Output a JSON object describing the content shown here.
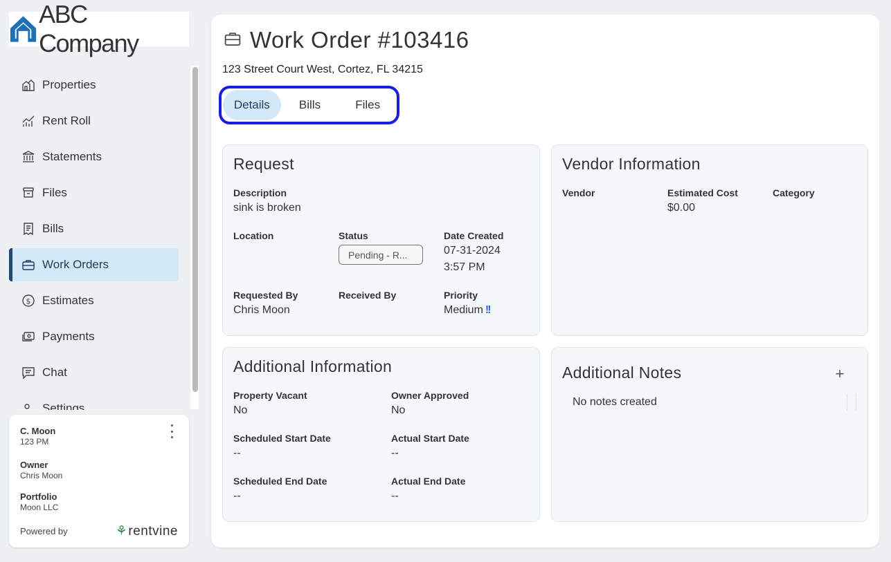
{
  "brand": {
    "logo_text": "ABC Company"
  },
  "sidebar": {
    "items": [
      {
        "label": "Properties",
        "icon": "building-icon",
        "active": false
      },
      {
        "label": "Rent Roll",
        "icon": "chart-icon",
        "active": false
      },
      {
        "label": "Statements",
        "icon": "bank-icon",
        "active": false
      },
      {
        "label": "Files",
        "icon": "archive-icon",
        "active": false
      },
      {
        "label": "Bills",
        "icon": "receipt-icon",
        "active": false
      },
      {
        "label": "Work Orders",
        "icon": "toolbox-icon",
        "active": true
      },
      {
        "label": "Estimates",
        "icon": "dollar-circle-icon",
        "active": false
      },
      {
        "label": "Payments",
        "icon": "cash-icon",
        "active": false
      },
      {
        "label": "Chat",
        "icon": "chat-icon",
        "active": false
      },
      {
        "label": "Settings",
        "icon": "settings-icon",
        "active": false
      }
    ]
  },
  "user_card": {
    "name": "C. Moon",
    "unit": "123 PM",
    "owner_label": "Owner",
    "owner_value": "Chris Moon",
    "portfolio_label": "Portfolio",
    "portfolio_value": "Moon LLC",
    "powered_by": "Powered by",
    "powered_brand": "rentvine"
  },
  "header": {
    "title": "Work Order #103416",
    "address": "123 Street Court West, Cortez, FL 34215"
  },
  "tabs": [
    {
      "label": "Details",
      "active": true
    },
    {
      "label": "Bills",
      "active": false
    },
    {
      "label": "Files",
      "active": false
    }
  ],
  "request": {
    "title": "Request",
    "description_label": "Description",
    "description_value": "sink is broken",
    "location_label": "Location",
    "status_label": "Status",
    "status_value": "Pending - R...",
    "date_created_label": "Date Created",
    "date_created_date": "07-31-2024",
    "date_created_time": "3:57 PM",
    "requested_by_label": "Requested By",
    "requested_by_value": "Chris Moon",
    "received_by_label": "Received By",
    "priority_label": "Priority",
    "priority_value": "Medium",
    "priority_icon": "!!"
  },
  "vendor": {
    "title": "Vendor Information",
    "vendor_label": "Vendor",
    "cost_label": "Estimated Cost",
    "cost_value": "$0.00",
    "category_label": "Category"
  },
  "additional": {
    "title": "Additional Information",
    "vacant_label": "Property Vacant",
    "vacant_value": "No",
    "approved_label": "Owner Approved",
    "approved_value": "No",
    "sched_start_label": "Scheduled Start Date",
    "sched_start_value": "--",
    "actual_start_label": "Actual Start Date",
    "actual_start_value": "--",
    "sched_end_label": "Scheduled End Date",
    "sched_end_value": "--",
    "actual_end_label": "Actual End Date",
    "actual_end_value": "--"
  },
  "notes": {
    "title": "Additional Notes",
    "add_glyph": "+",
    "empty_text": "No notes created"
  },
  "colors": {
    "accent": "#1e4a73",
    "active_bg": "#d3e9f7",
    "tab_focus": "#1a1ce0",
    "logo_blue": "#1f6fb5"
  }
}
